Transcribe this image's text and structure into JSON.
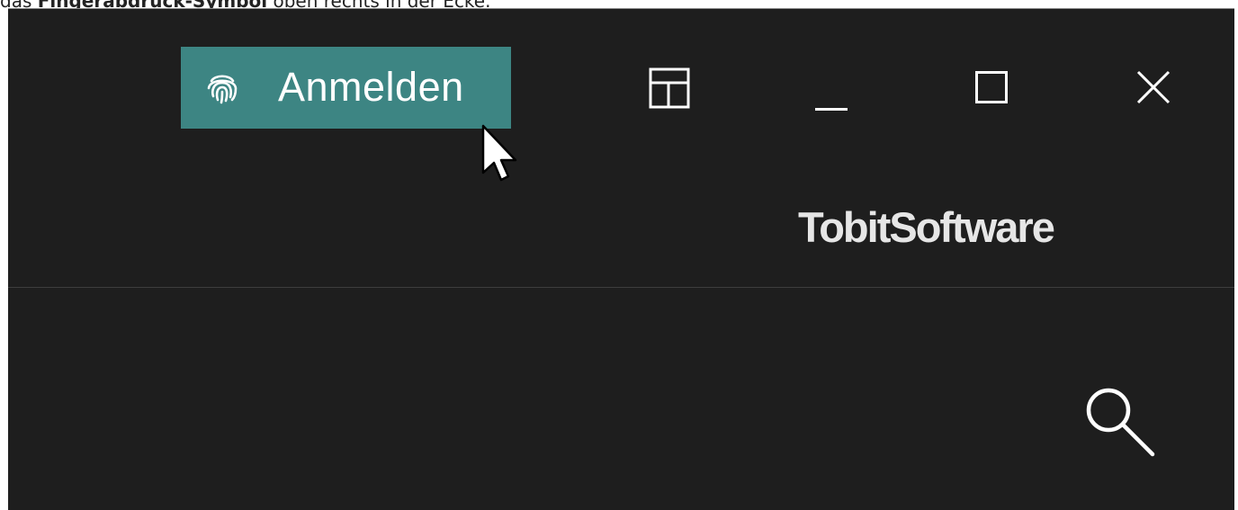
{
  "caption": {
    "prefix": "das ",
    "bold": "Fingerabdruck-Symbol",
    "suffix": " oben rechts in der Ecke."
  },
  "header": {
    "login_button": {
      "icon": "fingerprint-icon",
      "label": "Anmelden",
      "color": "#3d8583"
    },
    "window_controls": [
      "layout-icon",
      "minimize-icon",
      "maximize-icon",
      "close-icon"
    ],
    "logo_text": "TobitSoftware"
  },
  "main": {
    "search_icon": "search-icon"
  },
  "colors": {
    "background": "#1e1e1e",
    "accent": "#3d8583",
    "text": "#ffffff"
  }
}
